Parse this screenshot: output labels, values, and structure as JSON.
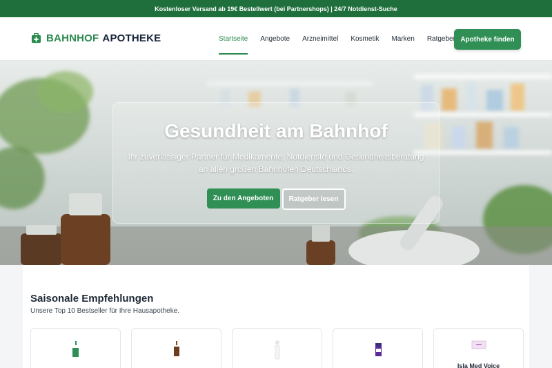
{
  "topbar": {
    "text": "Kostenloser Versand ab 19€ Bestellwert (bei Partnershops) | 24/7 Notdienst-Suche"
  },
  "header": {
    "logo_part1": "BAHNHOF",
    "logo_part2": "APOTHEKE",
    "logo_icon": "medical-kit-icon",
    "nav": [
      {
        "label": "Startseite",
        "active": true
      },
      {
        "label": "Angebote"
      },
      {
        "label": "Arzneimittel"
      },
      {
        "label": "Kosmetik"
      },
      {
        "label": "Marken"
      },
      {
        "label": "Ratgeber"
      }
    ],
    "cta_label": "Apotheke finden"
  },
  "hero": {
    "title": "Gesundheit am Bahnhof",
    "subtitle": "Ihr zuverlässiger Partner für Medikamente, Notdienste und Gesundheitsberatung an allen großen Bahnhöfen Deutschlands.",
    "primary_button": "Zu den Angeboten",
    "secondary_button": "Ratgeber lesen"
  },
  "recommendations": {
    "title": "Saisonale Empfehlungen",
    "subtitle": "Unsere Top 10 Bestseller für Ihre Hausapotheke.",
    "cards": [
      {
        "name": "",
        "icon": "green-bottle-icon"
      },
      {
        "name": "",
        "icon": "brown-bottle-icon"
      },
      {
        "name": "",
        "icon": "white-spray-icon"
      },
      {
        "name": "",
        "icon": "purple-bottle-icon"
      },
      {
        "name": "Isla Med Voice",
        "icon": "pink-box-icon"
      }
    ]
  },
  "colors": {
    "brand_green": "#2f8f55",
    "topbar_green": "#1f6f3c",
    "navy": "#17233a"
  }
}
